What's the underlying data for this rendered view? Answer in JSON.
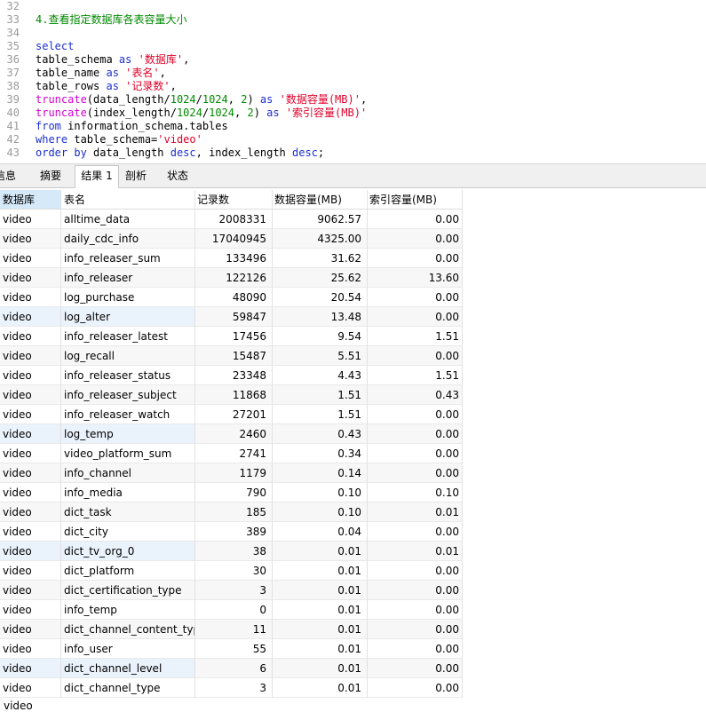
{
  "editor": {
    "lines": [
      {
        "n": "32",
        "parts": []
      },
      {
        "n": "33",
        "parts": [
          {
            "c": "cmt",
            "t": "4.查看指定数据库各表容量大小"
          }
        ]
      },
      {
        "n": "34",
        "parts": []
      },
      {
        "n": "35",
        "parts": [
          {
            "c": "kw",
            "t": "select"
          }
        ]
      },
      {
        "n": "36",
        "parts": [
          {
            "c": "plain",
            "t": "table_schema "
          },
          {
            "c": "kw",
            "t": "as"
          },
          {
            "c": "plain",
            "t": " "
          },
          {
            "c": "str",
            "t": "'数据库'"
          },
          {
            "c": "plain",
            "t": ","
          }
        ]
      },
      {
        "n": "37",
        "parts": [
          {
            "c": "plain",
            "t": "table_name "
          },
          {
            "c": "kw",
            "t": "as"
          },
          {
            "c": "plain",
            "t": " "
          },
          {
            "c": "str",
            "t": "'表名'"
          },
          {
            "c": "plain",
            "t": ","
          }
        ]
      },
      {
        "n": "38",
        "parts": [
          {
            "c": "plain",
            "t": "table_rows "
          },
          {
            "c": "kw",
            "t": "as"
          },
          {
            "c": "plain",
            "t": " "
          },
          {
            "c": "str",
            "t": "'记录数'"
          },
          {
            "c": "plain",
            "t": ","
          }
        ]
      },
      {
        "n": "39",
        "parts": [
          {
            "c": "fn",
            "t": "truncate"
          },
          {
            "c": "plain",
            "t": "(data_length/"
          },
          {
            "c": "num",
            "t": "1024"
          },
          {
            "c": "plain",
            "t": "/"
          },
          {
            "c": "num",
            "t": "1024"
          },
          {
            "c": "plain",
            "t": ", "
          },
          {
            "c": "num",
            "t": "2"
          },
          {
            "c": "plain",
            "t": ") "
          },
          {
            "c": "kw",
            "t": "as"
          },
          {
            "c": "plain",
            "t": " "
          },
          {
            "c": "str",
            "t": "'数据容量(MB)'"
          },
          {
            "c": "plain",
            "t": ","
          }
        ]
      },
      {
        "n": "40",
        "parts": [
          {
            "c": "fn",
            "t": "truncate"
          },
          {
            "c": "plain",
            "t": "(index_length/"
          },
          {
            "c": "num",
            "t": "1024"
          },
          {
            "c": "plain",
            "t": "/"
          },
          {
            "c": "num",
            "t": "1024"
          },
          {
            "c": "plain",
            "t": ", "
          },
          {
            "c": "num",
            "t": "2"
          },
          {
            "c": "plain",
            "t": ") "
          },
          {
            "c": "kw",
            "t": "as"
          },
          {
            "c": "plain",
            "t": " "
          },
          {
            "c": "str",
            "t": "'索引容量(MB)'"
          }
        ]
      },
      {
        "n": "41",
        "parts": [
          {
            "c": "kw",
            "t": "from"
          },
          {
            "c": "plain",
            "t": " information_schema.tables"
          }
        ]
      },
      {
        "n": "42",
        "parts": [
          {
            "c": "kw",
            "t": "where"
          },
          {
            "c": "plain",
            "t": " table_schema="
          },
          {
            "c": "str",
            "t": "'video'"
          }
        ]
      },
      {
        "n": "43",
        "parts": [
          {
            "c": "kw",
            "t": "order by"
          },
          {
            "c": "plain",
            "t": " data_length "
          },
          {
            "c": "kw",
            "t": "desc"
          },
          {
            "c": "plain",
            "t": ", index_length "
          },
          {
            "c": "kw",
            "t": "desc"
          },
          {
            "c": "plain",
            "t": ";"
          }
        ]
      }
    ]
  },
  "tabs": [
    {
      "label": "信息",
      "active": false
    },
    {
      "label": "摘要",
      "active": false
    },
    {
      "label": "结果 1",
      "active": true
    },
    {
      "label": "剖析",
      "active": false
    },
    {
      "label": "状态",
      "active": false
    }
  ],
  "grid": {
    "columns": [
      "数据库",
      "表名",
      "记录数",
      "数据容量(MB)",
      "索引容量(MB)"
    ],
    "rows": [
      [
        "video",
        "alltime_data",
        "2008331",
        "9062.57",
        "0.00"
      ],
      [
        "video",
        "daily_cdc_info",
        "17040945",
        "4325.00",
        "0.00"
      ],
      [
        "video",
        "info_releaser_sum",
        "133496",
        "31.62",
        "0.00"
      ],
      [
        "video",
        "info_releaser",
        "122126",
        "25.62",
        "13.60"
      ],
      [
        "video",
        "log_purchase",
        "48090",
        "20.54",
        "0.00"
      ],
      [
        "video",
        "log_alter",
        "59847",
        "13.48",
        "0.00"
      ],
      [
        "video",
        "info_releaser_latest",
        "17456",
        "9.54",
        "1.51"
      ],
      [
        "video",
        "log_recall",
        "15487",
        "5.51",
        "0.00"
      ],
      [
        "video",
        "info_releaser_status",
        "23348",
        "4.43",
        "1.51"
      ],
      [
        "video",
        "info_releaser_subject",
        "11868",
        "1.51",
        "0.43"
      ],
      [
        "video",
        "info_releaser_watch",
        "27201",
        "1.51",
        "0.00"
      ],
      [
        "video",
        "log_temp",
        "2460",
        "0.43",
        "0.00"
      ],
      [
        "video",
        "video_platform_sum",
        "2741",
        "0.34",
        "0.00"
      ],
      [
        "video",
        "info_channel",
        "1179",
        "0.14",
        "0.00"
      ],
      [
        "video",
        "info_media",
        "790",
        "0.10",
        "0.10"
      ],
      [
        "video",
        "dict_task",
        "185",
        "0.10",
        "0.01"
      ],
      [
        "video",
        "dict_city",
        "389",
        "0.04",
        "0.00"
      ],
      [
        "video",
        "dict_tv_org_0",
        "38",
        "0.01",
        "0.01"
      ],
      [
        "video",
        "dict_platform",
        "30",
        "0.01",
        "0.00"
      ],
      [
        "video",
        "dict_certification_type",
        "3",
        "0.01",
        "0.00"
      ],
      [
        "video",
        "info_temp",
        "0",
        "0.01",
        "0.00"
      ],
      [
        "video",
        "dict_channel_content_type",
        "11",
        "0.01",
        "0.00"
      ],
      [
        "video",
        "info_user",
        "55",
        "0.01",
        "0.00"
      ],
      [
        "video",
        "dict_channel_level",
        "6",
        "0.01",
        "0.00"
      ],
      [
        "video",
        "dict_channel_type",
        "3",
        "0.01",
        "0.00"
      ]
    ]
  },
  "status": {
    "text": "video"
  }
}
